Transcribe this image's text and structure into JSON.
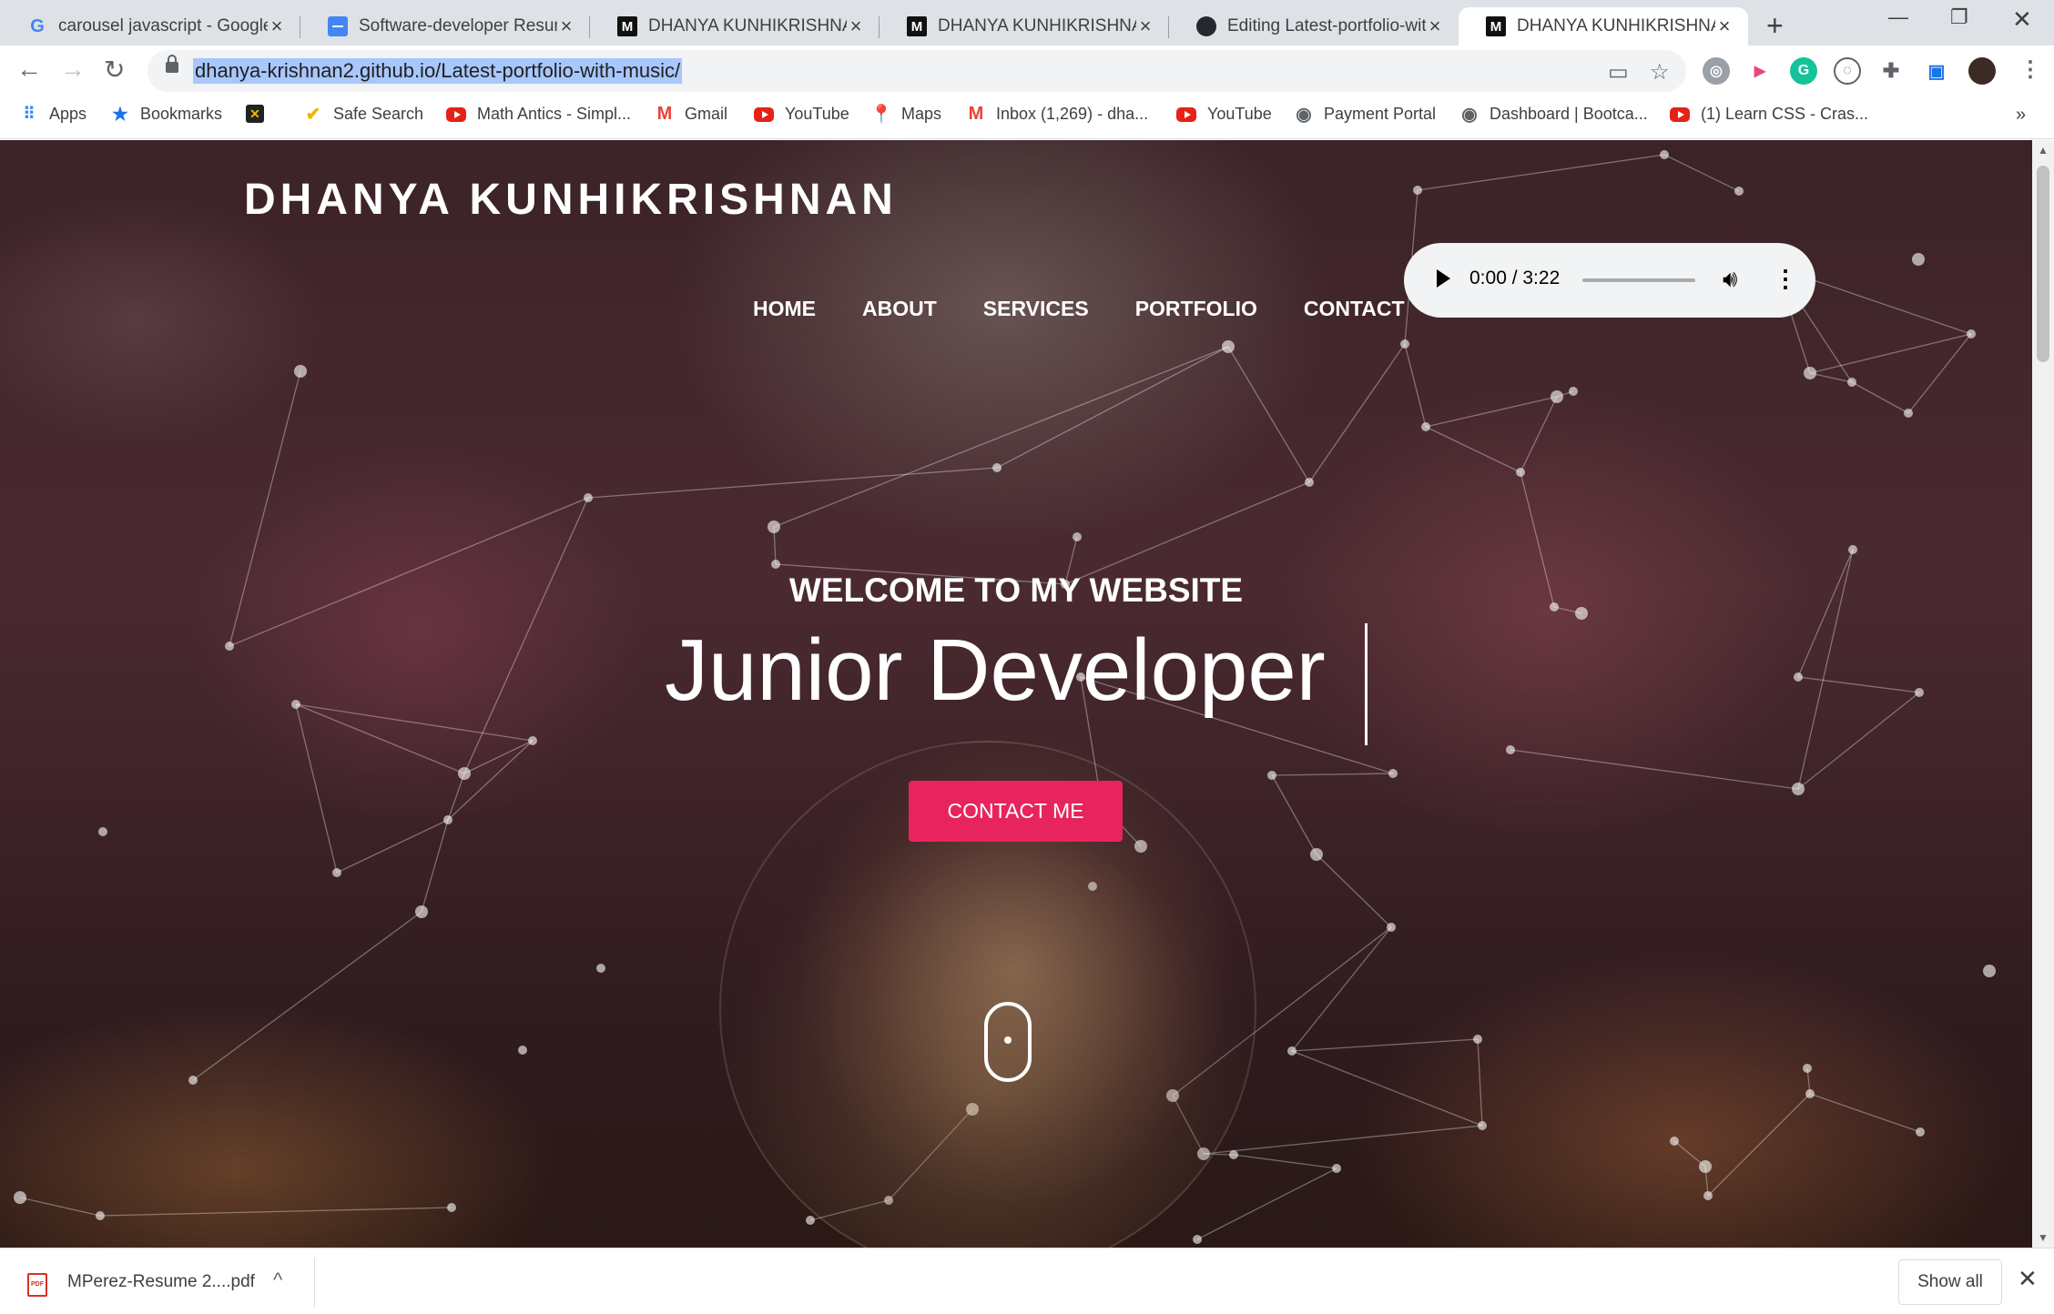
{
  "browser": {
    "tabs": [
      {
        "title": "carousel javascript - Google",
        "icon": "google-g-icon"
      },
      {
        "title": "Software-developer Resume",
        "icon": "google-docs-icon"
      },
      {
        "title": "DHANYA KUNHIKRISHNAN",
        "icon": "m-logo-icon"
      },
      {
        "title": "DHANYA KUNHIKRISHNAN",
        "icon": "m-logo-icon"
      },
      {
        "title": "Editing Latest-portfolio-with",
        "icon": "github-icon"
      },
      {
        "title": "DHANYA KUNHIKRISHNAN",
        "icon": "m-logo-icon",
        "active": true
      }
    ],
    "url": "dhanya-krishnan2.github.io/Latest-portfolio-with-music/",
    "bookmarks": [
      {
        "label": "Apps",
        "icon": "apps-grid-icon"
      },
      {
        "label": "Bookmarks",
        "icon": "star-icon"
      },
      {
        "label": "",
        "icon": "colorful-logo-icon"
      },
      {
        "label": "Safe Search",
        "icon": "checkmark-icon"
      },
      {
        "label": "Math Antics - Simpl...",
        "icon": "youtube-icon"
      },
      {
        "label": "Gmail",
        "icon": "gmail-icon"
      },
      {
        "label": "YouTube",
        "icon": "youtube-icon"
      },
      {
        "label": "Maps",
        "icon": "maps-pin-icon"
      },
      {
        "label": "Inbox (1,269) - dha...",
        "icon": "gmail-icon"
      },
      {
        "label": "YouTube",
        "icon": "youtube-icon"
      },
      {
        "label": "Payment Portal",
        "icon": "globe-icon"
      },
      {
        "label": "Dashboard | Bootca...",
        "icon": "globe-icon"
      },
      {
        "label": "(1) Learn CSS - Cras...",
        "icon": "youtube-icon"
      }
    ]
  },
  "page": {
    "brand": "DHANYA KUNHIKRISHNAN",
    "nav": [
      "HOME",
      "ABOUT",
      "SERVICES",
      "PORTFOLIO",
      "CONTACT"
    ],
    "audio": {
      "time": "0:00 / 3:22"
    },
    "welcome": "WELCOME TO MY WEBSITE",
    "role": "Junior Developer",
    "cta": "CONTACT ME",
    "accent": "#e7245e"
  },
  "downloads": {
    "file": "MPerez-Resume 2....pdf",
    "show_all": "Show all"
  }
}
